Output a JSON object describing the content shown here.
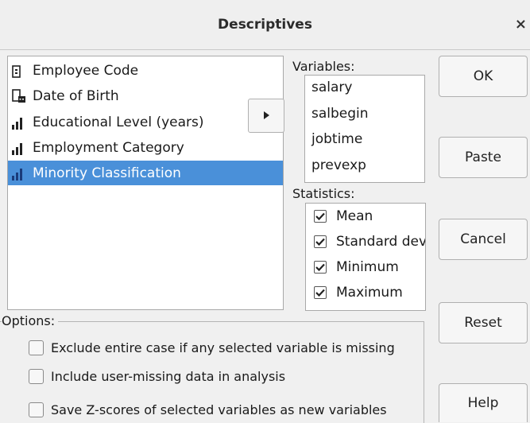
{
  "window": {
    "title": "Descriptives",
    "close_glyph": "×"
  },
  "source_list": {
    "items": [
      {
        "label": "Employee Code",
        "icon": "string-id-icon",
        "selected": false
      },
      {
        "label": "Date of Birth",
        "icon": "date-icon",
        "selected": false
      },
      {
        "label": "Educational Level (years)",
        "icon": "scale-icon",
        "selected": false
      },
      {
        "label": "Employment Category",
        "icon": "scale-icon",
        "selected": false
      },
      {
        "label": "Minority Classification",
        "icon": "scale-icon",
        "selected": true
      }
    ]
  },
  "variables": {
    "label": "Variables:",
    "items": [
      "salary",
      "salbegin",
      "jobtime",
      "prevexp"
    ]
  },
  "statistics": {
    "label": "Statistics:",
    "items": [
      {
        "label": "Mean",
        "checked": true
      },
      {
        "label": "Standard dev",
        "checked": true
      },
      {
        "label": "Minimum",
        "checked": true
      },
      {
        "label": "Maximum",
        "checked": true
      }
    ]
  },
  "options": {
    "label": "Options:",
    "items": [
      {
        "label": "Exclude entire case if any selected variable is missing",
        "checked": false
      },
      {
        "label": "Include user-missing data in analysis",
        "checked": false
      },
      {
        "label": "Save Z-scores of selected variables as new variables",
        "checked": false
      }
    ]
  },
  "buttons": {
    "ok": "OK",
    "paste": "Paste",
    "cancel": "Cancel",
    "reset": "Reset",
    "help": "Help"
  },
  "colors": {
    "selection": "#4a90d9",
    "background": "#f0f0f0"
  }
}
